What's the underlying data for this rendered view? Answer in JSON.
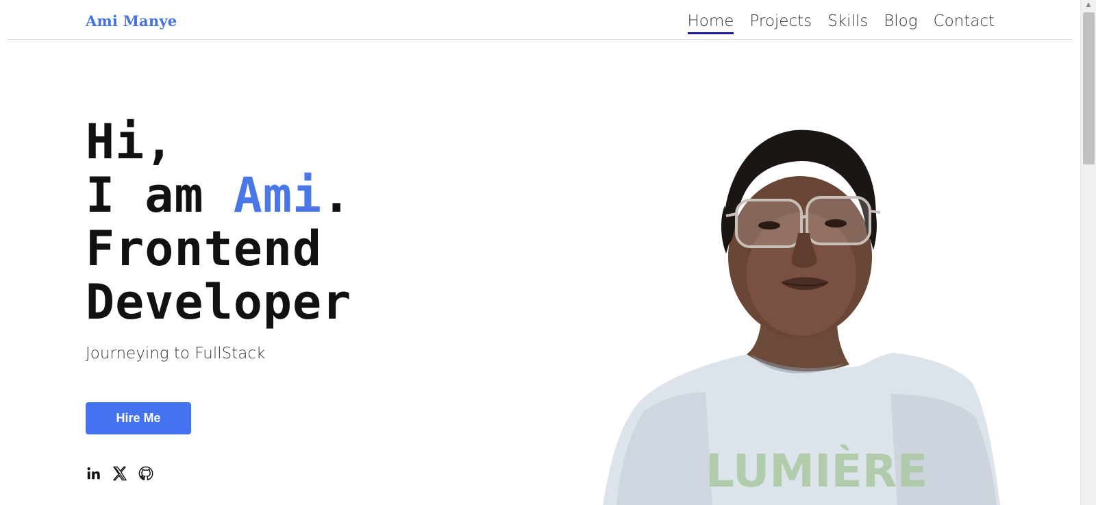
{
  "header": {
    "logo": "Ami Manye",
    "nav": [
      {
        "label": "Home",
        "active": true
      },
      {
        "label": "Projects",
        "active": false
      },
      {
        "label": "Skills",
        "active": false
      },
      {
        "label": "Blog",
        "active": false
      },
      {
        "label": "Contact",
        "active": false
      }
    ]
  },
  "hero": {
    "line1": "Hi,",
    "line2_prefix": "I am ",
    "line2_name": "Ami",
    "line2_suffix": ".",
    "line3": "Frontend",
    "line4": "Developer",
    "subtitle": "Journeying to FullStack",
    "cta_label": "Hire Me",
    "portrait_shirt_text": "LUMIÈRE"
  },
  "socials": [
    {
      "icon": "linkedin-icon"
    },
    {
      "icon": "x-twitter-icon"
    },
    {
      "icon": "github-icon"
    }
  ],
  "colors": {
    "accent": "#4a77e8",
    "button": "#4472ef",
    "nav_active_underline": "#1a1aa6"
  }
}
